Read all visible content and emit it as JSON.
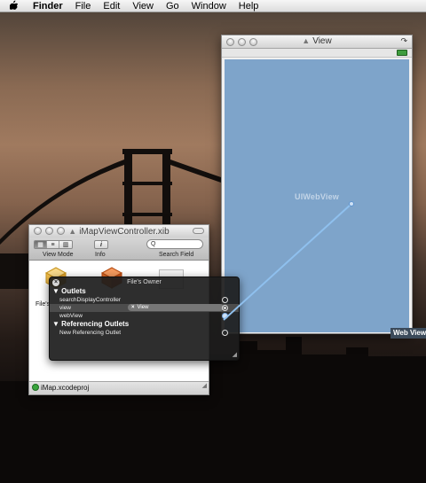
{
  "menubar": {
    "apple": "",
    "app": "Finder",
    "items": [
      "File",
      "Edit",
      "View",
      "Go",
      "Window",
      "Help"
    ]
  },
  "view_window": {
    "title": "View",
    "canvas_label": "UIWebView"
  },
  "tooltip": "Web View",
  "xib_window": {
    "title": "iMapViewController.xib",
    "toolbar": {
      "view_mode_label": "View Mode",
      "info_label": "Info",
      "search_label": "Search Field",
      "search_placeholder": "Q"
    },
    "objects": [
      {
        "label": "File's"
      }
    ],
    "project": "iMap.xcodeproj"
  },
  "hud": {
    "title": "File's Owner",
    "outlets_header": "Outlets",
    "outlets": [
      {
        "name": "searchDisplayController",
        "target": ""
      },
      {
        "name": "view",
        "target": "View"
      },
      {
        "name": "webView",
        "target": ""
      }
    ],
    "referencing_header": "Referencing Outlets",
    "referencing": [
      {
        "name": "New Referencing Outlet"
      }
    ]
  },
  "colors": {
    "canvas": "#7ea4ca",
    "connection_line": "#8fc0ee",
    "hud_bg": "#1c1c1c"
  }
}
